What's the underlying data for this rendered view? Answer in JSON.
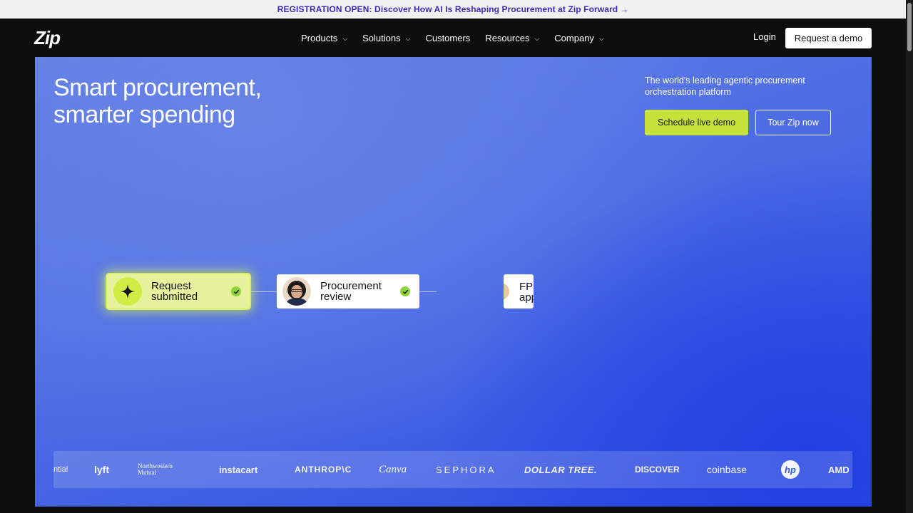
{
  "banner": {
    "text": "REGISTRATION OPEN: Discover How AI Is Reshaping Procurement at Zip Forward",
    "arrow": "→"
  },
  "nav": {
    "logo": "Zip",
    "items": [
      {
        "label": "Products",
        "has_dropdown": true
      },
      {
        "label": "Solutions",
        "has_dropdown": true
      },
      {
        "label": "Customers",
        "has_dropdown": false
      },
      {
        "label": "Resources",
        "has_dropdown": true
      },
      {
        "label": "Company",
        "has_dropdown": true
      }
    ],
    "chevron": "⌵",
    "login": "Login",
    "request_demo": "Request a demo"
  },
  "hero": {
    "headline_line1": "Smart procurement,",
    "headline_line2": "smarter spending",
    "tagline": "The world's leading agentic procurement orchestration platform",
    "cta_primary": "Schedule live demo",
    "cta_secondary": "Tour Zip now"
  },
  "workflow": {
    "steps": [
      {
        "line1": "Request",
        "line2": "submitted",
        "status": "done"
      },
      {
        "line1": "Procurement",
        "line2": "review",
        "status": "done"
      },
      {
        "line1": "FP",
        "line2": "app",
        "status": "partial"
      }
    ]
  },
  "logos": {
    "items": [
      "ntial",
      "lyft",
      "Northwestern",
      "Mutual",
      "instacart",
      "ANTHROP\\C",
      "Canva",
      "SEPHORA",
      "DOLLAR TREE.",
      "DISCOVER",
      "coinbase",
      "hp",
      "AMD"
    ]
  },
  "colors": {
    "banner_text": "#3b2bb8",
    "accent_green": "#c6e13a",
    "hero_blue": "#4e6de4",
    "check_green": "#8ed33b"
  }
}
